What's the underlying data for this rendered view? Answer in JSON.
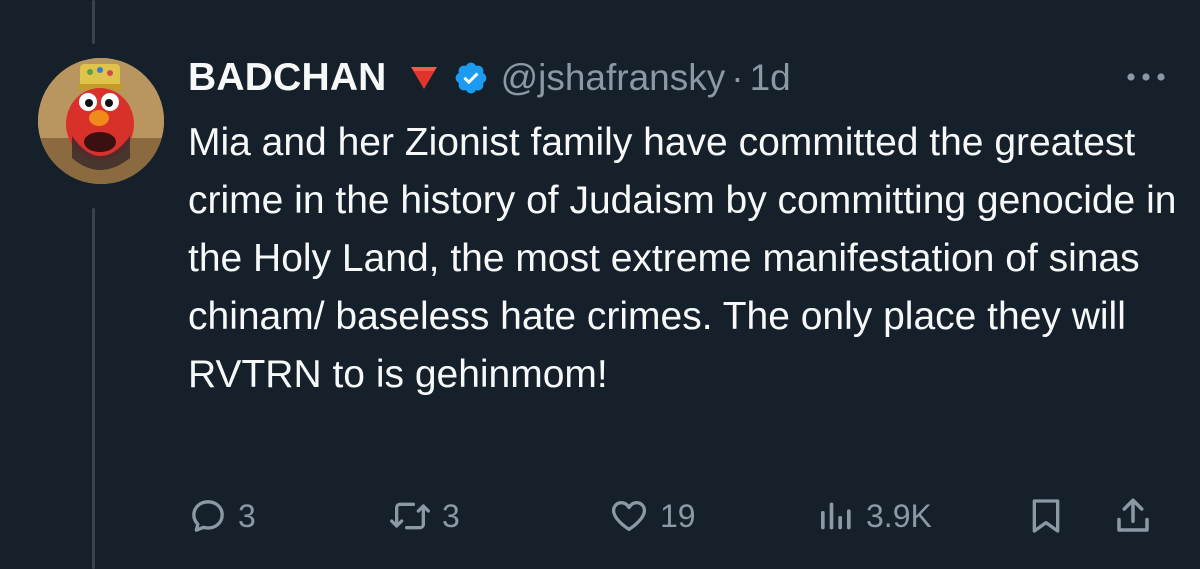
{
  "tweet": {
    "display_name": "BADCHAN",
    "handle": "@jshafransky",
    "separator": "·",
    "time": "1d",
    "text": "Mia and her Zionist family have committed the greatest crime in the history of Judaism by committing genocide in the Holy Land, the most extreme manifestation of sinas chinam/ baseless hate crimes. The only place they will RVTRN to is gehinmom!",
    "flag_emoji": "red-triangle-pointed-down-icon",
    "verified_color": "#1d9bf0"
  },
  "actions": {
    "replies": "3",
    "reposts": "3",
    "likes": "19",
    "views": "3.9K"
  },
  "icons": {
    "reply": "reply-icon",
    "repost": "repost-icon",
    "like": "heart-icon",
    "views": "views-icon",
    "bookmark": "bookmark-icon",
    "share": "share-icon",
    "more": "more-icon"
  },
  "colors": {
    "background": "#15202b",
    "text": "#f7f9f9",
    "muted": "#8b98a5",
    "thread_line": "#38444d"
  }
}
